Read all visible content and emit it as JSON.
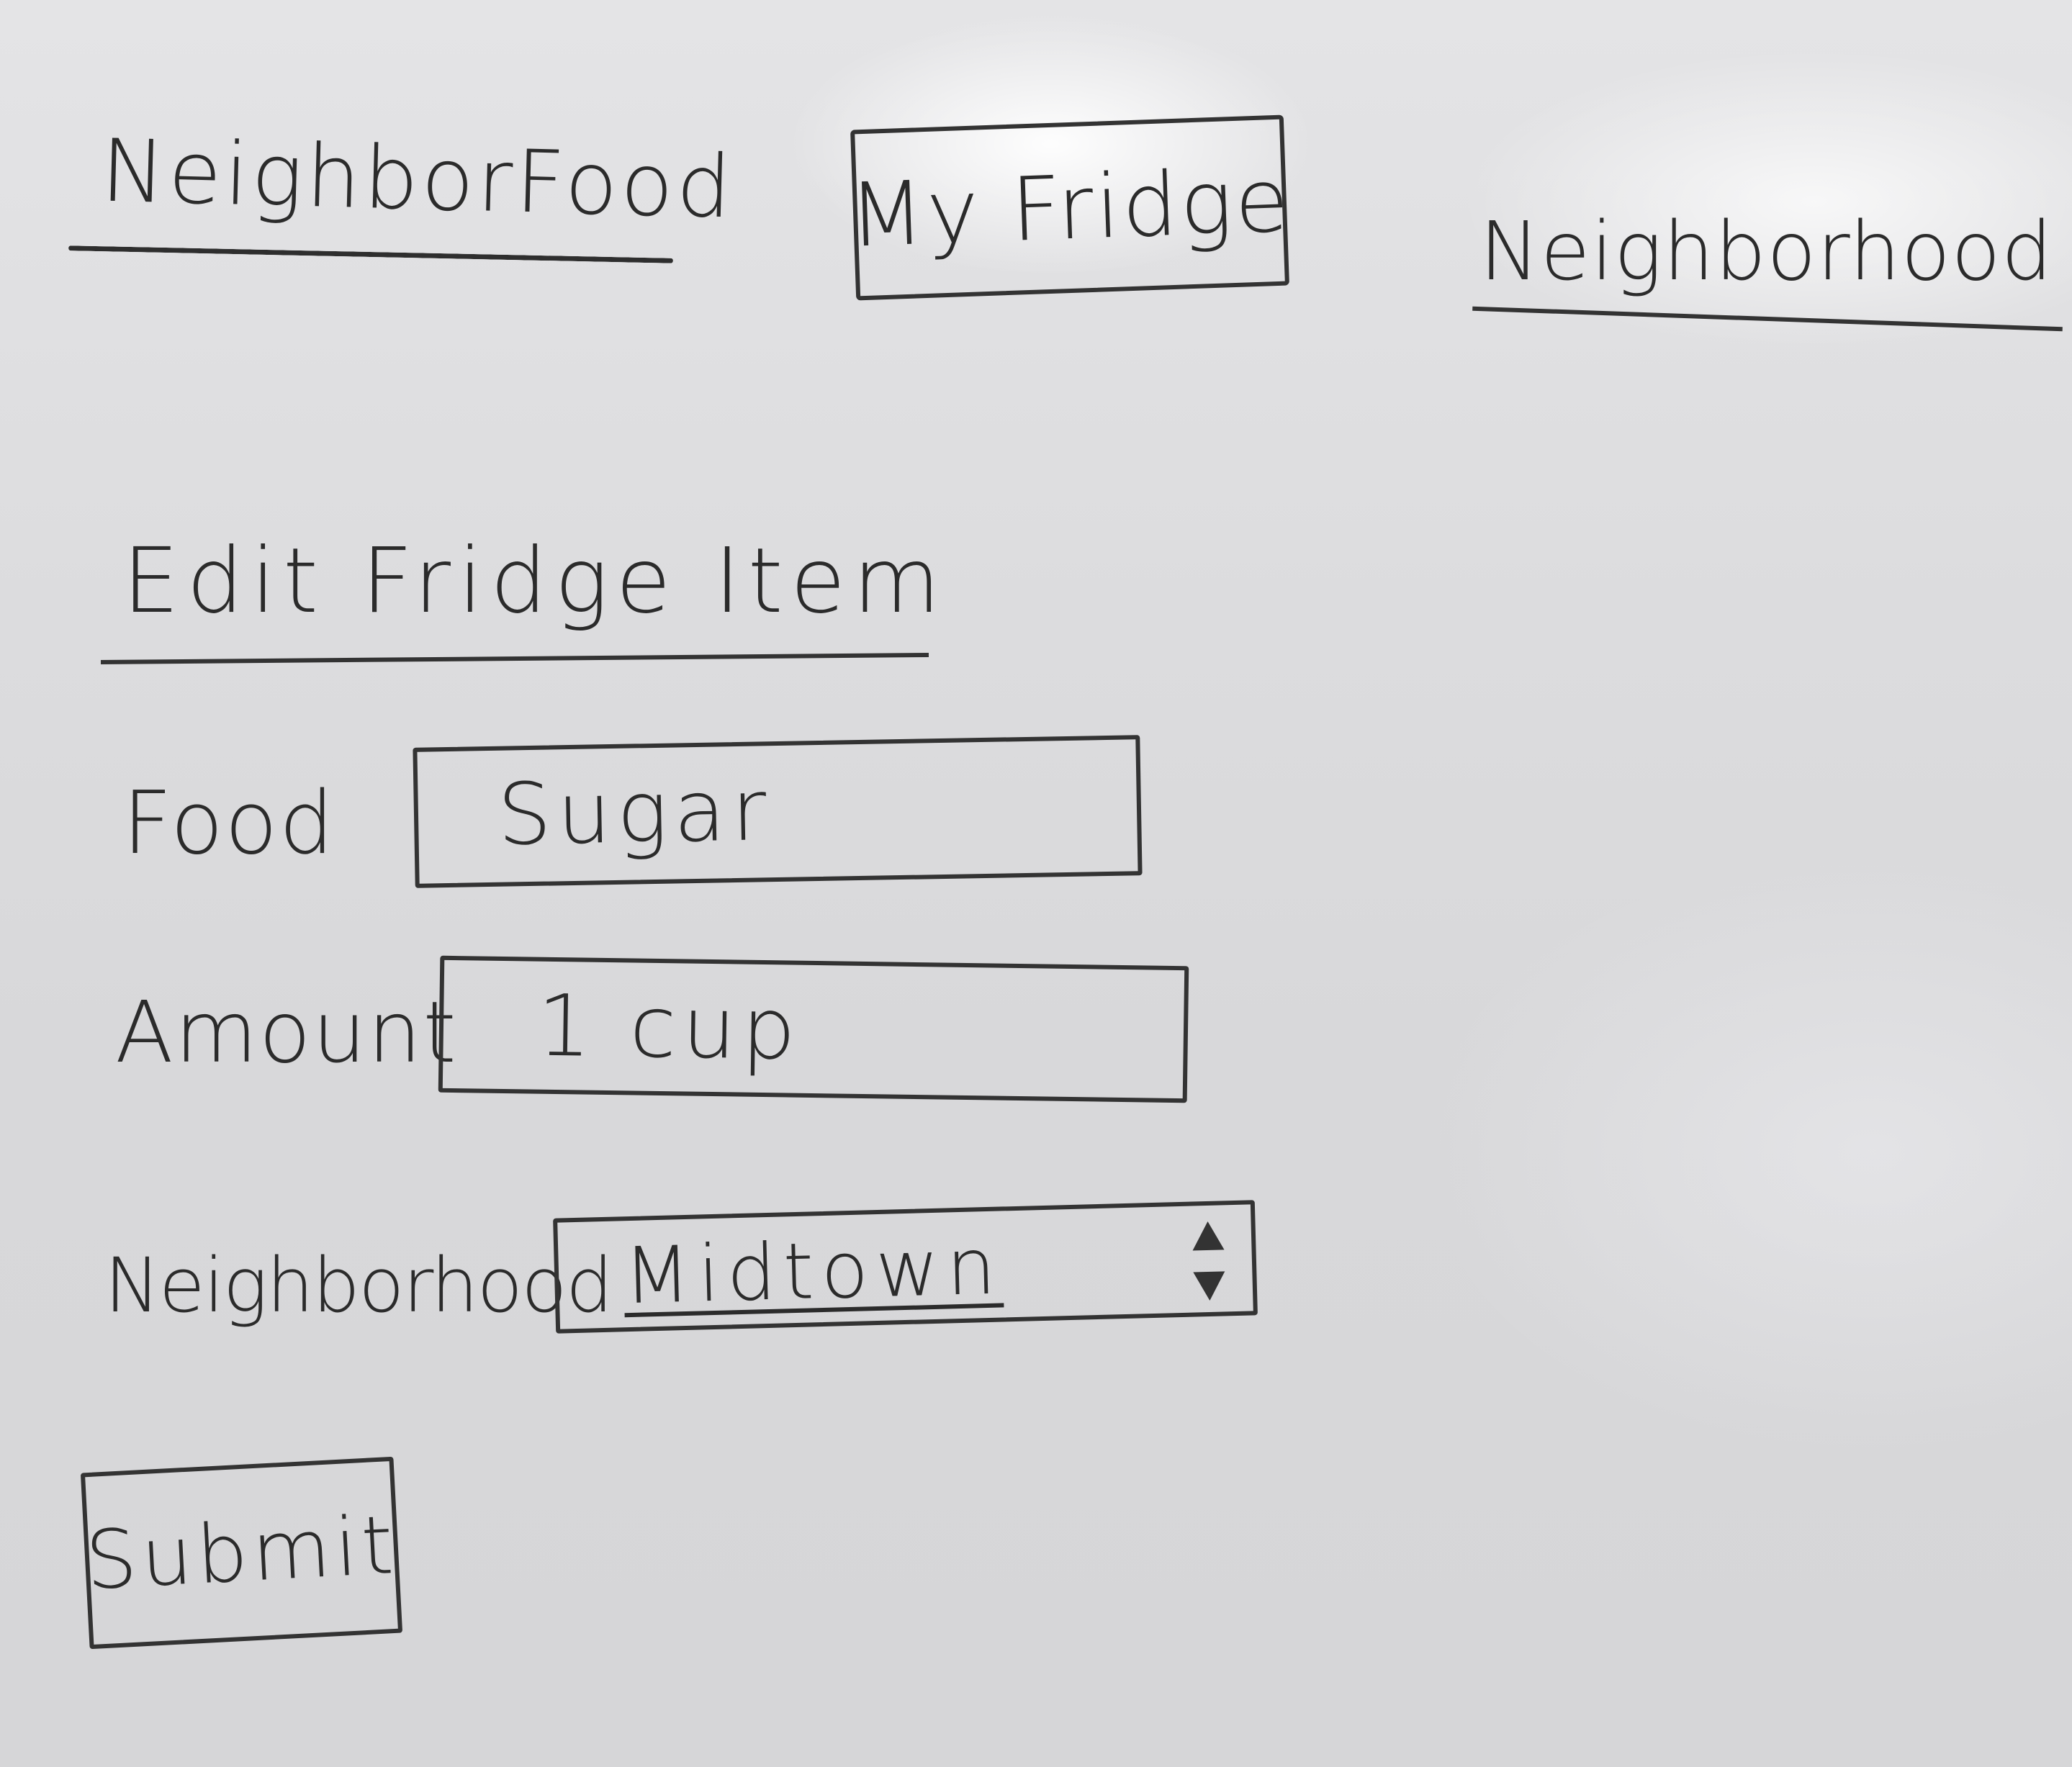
{
  "header": {
    "brand": "NeighborFood",
    "nav": {
      "my_fridge": "My Fridge",
      "neighborhood": "Neighborhood"
    }
  },
  "form": {
    "title": "Edit Fridge Item",
    "fields": {
      "food": {
        "label": "Food",
        "value": "Sugar"
      },
      "amount": {
        "label": "Amount",
        "value": "1 cup"
      },
      "neighborhood": {
        "label": "Neighborhood",
        "value": "Midtown"
      }
    },
    "submit_label": "Submit"
  },
  "icons": {
    "select_arrows": "chevron-up-down-icon"
  }
}
